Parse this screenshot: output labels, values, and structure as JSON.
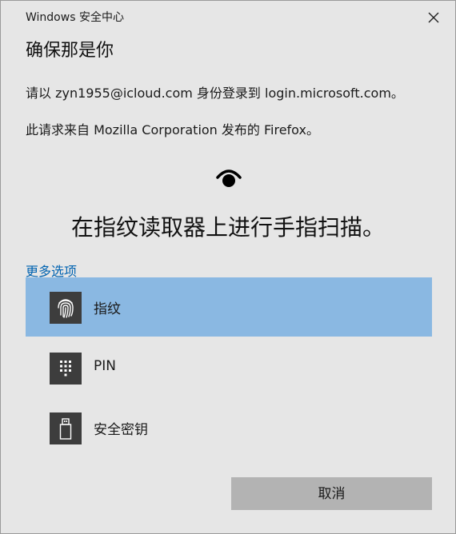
{
  "window": {
    "title": "Windows 安全中心"
  },
  "dialog": {
    "heading": "确保那是你",
    "signin_line": "请以 zyn1955@icloud.com 身份登录到 login.microsoft.com。",
    "publisher_line": "此请求来自 Mozilla Corporation 发布的 Firefox。",
    "prompt": "在指纹读取器上进行手指扫描。",
    "more_options": "更多选项"
  },
  "options": [
    {
      "label": "指纹",
      "icon": "fingerprint-icon",
      "selected": true
    },
    {
      "label": "PIN",
      "icon": "pin-keypad-icon",
      "selected": false
    },
    {
      "label": "安全密钥",
      "icon": "usb-key-icon",
      "selected": false
    }
  ],
  "buttons": {
    "cancel": "取消"
  },
  "colors": {
    "background": "#e6e6e6",
    "selected_option": "#8ab8e2",
    "link": "#0063b1",
    "icon_tile": "#3d3d3d",
    "cancel_button": "#b3b3b3"
  }
}
